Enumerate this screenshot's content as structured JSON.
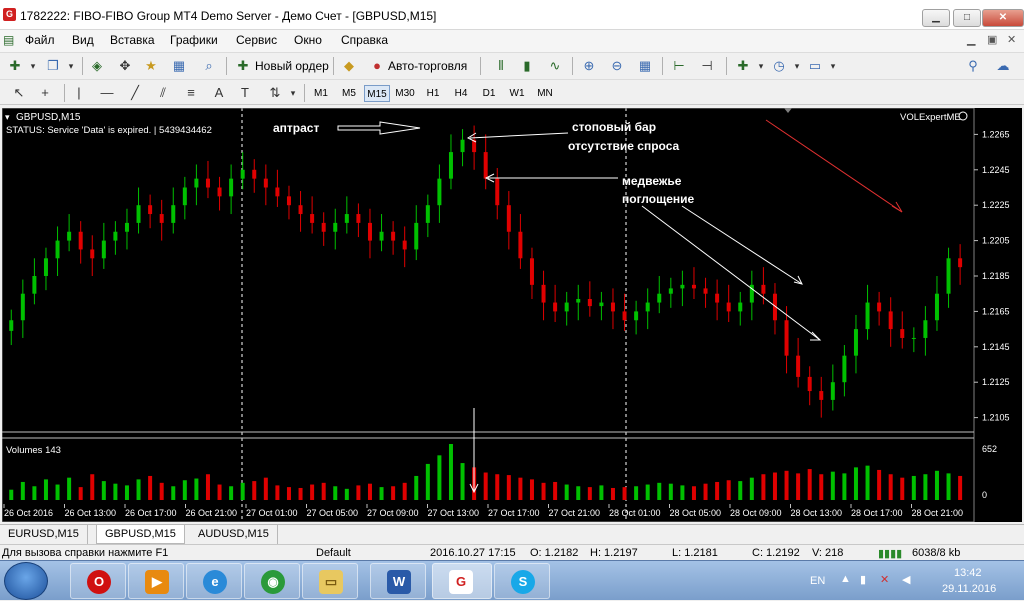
{
  "window": {
    "title": "1782222: FIBO-FIBO Group MT4 Demo Server - Демо Счет - [GBPUSD,M15]",
    "app_icon": "G"
  },
  "menu": [
    "Файл",
    "Вид",
    "Вставка",
    "Графики",
    "Сервис",
    "Окно",
    "Справка"
  ],
  "toolbar": {
    "new_order": "Новый ордер",
    "autotrading": "Авто-торговля",
    "timeframes": [
      "M1",
      "M5",
      "M15",
      "M30",
      "H1",
      "H4",
      "D1",
      "W1",
      "MN"
    ],
    "active_timeframe": "M15"
  },
  "chart": {
    "symbol_label": "GBPUSD,M15",
    "status_text": "STATUS:  Service 'Data' is expired.  | 5439434462",
    "expert_label": "VOLExpertME",
    "volume_label": "Volumes 143",
    "colors": {
      "background": "#000000",
      "bull": "#00c000",
      "bear": "#e00000",
      "grid": "#ffffff",
      "text": "#ffffff"
    },
    "annotations": {
      "upthrust": "аптраст",
      "stop_bar": "стоповый бар",
      "no_demand": "отсутствие спроса",
      "bearish_line1": "медвежье",
      "bearish_line2": "поглощение"
    }
  },
  "chart_data": {
    "type": "candlestick",
    "title": "GBPUSD,M15",
    "y_ticks": [
      "1.2265",
      "1.2245",
      "1.2225",
      "1.2205",
      "1.2185",
      "1.2165",
      "1.2145",
      "1.2125",
      "1.2105"
    ],
    "ylim": [
      1.2098,
      1.2272
    ],
    "volume_ticks": [
      "652",
      "0"
    ],
    "x_ticks": [
      "26 Oct 2016",
      "26 Oct 13:00",
      "26 Oct 17:00",
      "26 Oct 21:00",
      "27 Oct 01:00",
      "27 Oct 05:00",
      "27 Oct 09:00",
      "27 Oct 13:00",
      "27 Oct 17:00",
      "27 Oct 21:00",
      "28 Oct 01:00",
      "28 Oct 05:00",
      "28 Oct 09:00",
      "28 Oct 13:00",
      "28 Oct 17:00",
      "28 Oct 21:00"
    ],
    "bar_closes": [
      1.216,
      1.2175,
      1.2185,
      1.2195,
      1.2205,
      1.221,
      1.22,
      1.2195,
      1.2205,
      1.221,
      1.2215,
      1.2225,
      1.222,
      1.2215,
      1.2225,
      1.2235,
      1.224,
      1.2235,
      1.223,
      1.224,
      1.2245,
      1.224,
      1.2235,
      1.223,
      1.2225,
      1.222,
      1.2215,
      1.221,
      1.2215,
      1.222,
      1.2215,
      1.2205,
      1.221,
      1.2205,
      1.22,
      1.2215,
      1.2225,
      1.224,
      1.2255,
      1.2262,
      1.2255,
      1.224,
      1.2225,
      1.221,
      1.2195,
      1.218,
      1.217,
      1.2165,
      1.217,
      1.2172,
      1.2168,
      1.217,
      1.2165,
      1.216,
      1.2165,
      1.217,
      1.2175,
      1.2178,
      1.218,
      1.2178,
      1.2175,
      1.217,
      1.2165,
      1.217,
      1.218,
      1.2175,
      1.216,
      1.214,
      1.2128,
      1.212,
      1.2115,
      1.2125,
      1.214,
      1.2155,
      1.217,
      1.2165,
      1.2155,
      1.215,
      1.215,
      1.216,
      1.2175,
      1.2195,
      1.219
    ],
    "volumes": [
      120,
      210,
      160,
      240,
      180,
      260,
      150,
      300,
      220,
      190,
      170,
      240,
      280,
      200,
      160,
      230,
      250,
      300,
      180,
      160,
      200,
      220,
      260,
      170,
      150,
      140,
      180,
      200,
      160,
      130,
      170,
      190,
      150,
      160,
      200,
      280,
      420,
      520,
      652,
      430,
      380,
      320,
      300,
      290,
      260,
      240,
      200,
      210,
      180,
      160,
      150,
      170,
      140,
      150,
      160,
      180,
      200,
      190,
      170,
      160,
      190,
      210,
      230,
      220,
      260,
      300,
      320,
      340,
      310,
      360,
      300,
      330,
      310,
      380,
      400,
      350,
      300,
      260,
      280,
      300,
      340,
      310,
      280
    ]
  },
  "tabs": [
    "EURUSD,M15",
    "GBPUSD,M15",
    "AUDUSD,M15"
  ],
  "active_tab": "GBPUSD,M15",
  "status": {
    "help": "Для вызова справки нажмите F1",
    "profile": "Default",
    "time": "2016.10.27 17:15",
    "open": "O: 1.2182",
    "high": "H: 1.2197",
    "low": "L: 1.2181",
    "close": "C: 1.2192",
    "volume": "V: 218",
    "traffic": "6038/8 kb"
  },
  "taskbar": {
    "lang": "EN",
    "clock_time": "13:42",
    "clock_date": "29.11.2016"
  }
}
